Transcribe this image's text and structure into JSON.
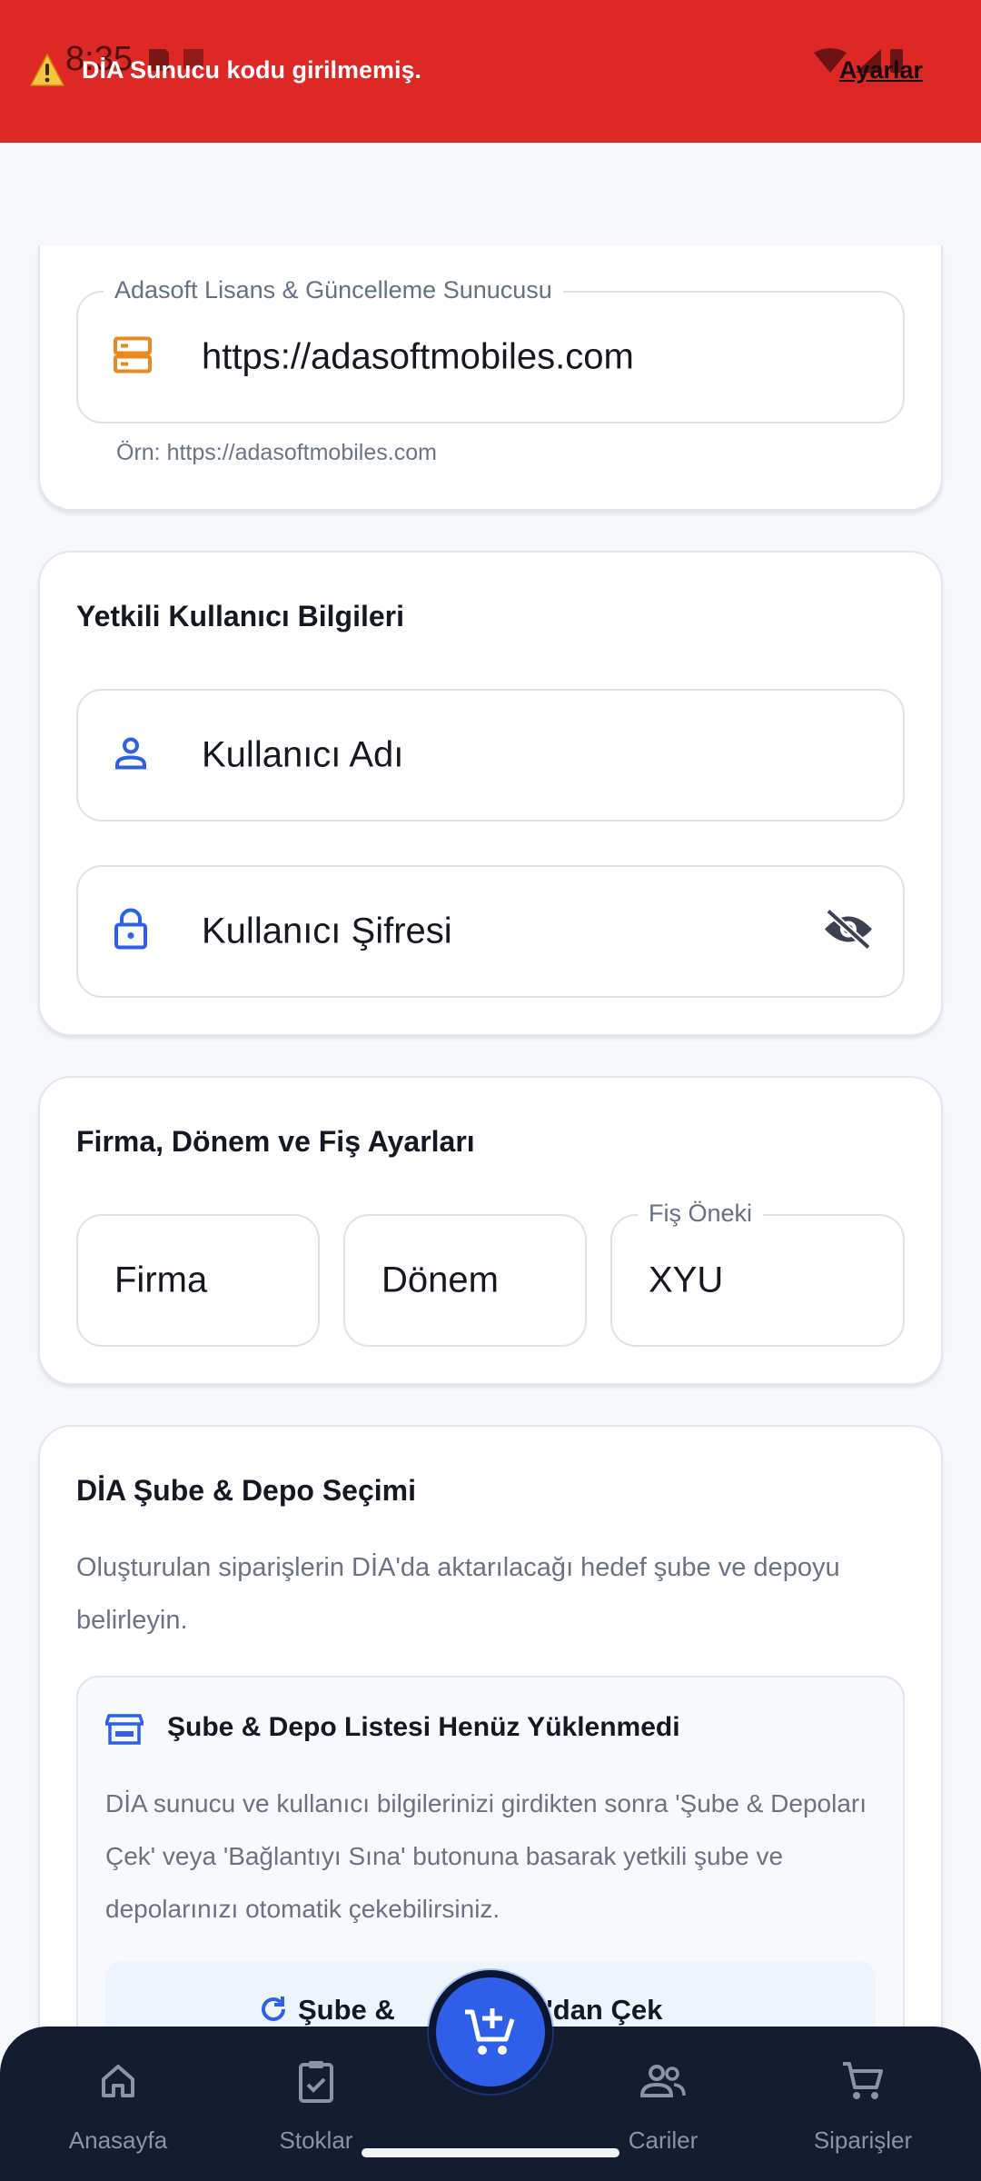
{
  "status_bar": {
    "time": "8:35"
  },
  "banner": {
    "message": "DİA Sunucu kodu girilmemiş.",
    "settings_link": "Ayarlar",
    "color": "#dd2826"
  },
  "server_card": {
    "field_label": "Adasoft Lisans & Güncelleme Sunucusu",
    "field_value": "https://adasoftmobiles.com",
    "helper": "Örn: https://adasoftmobiles.com",
    "icon": "server-icon"
  },
  "user_card": {
    "title": "Yetkili Kullanıcı Bilgileri",
    "username_placeholder": "Kullanıcı Adı",
    "password_placeholder": "Kullanıcı Şifresi"
  },
  "company_card": {
    "title": "Firma, Dönem ve Fiş Ayarları",
    "firma_placeholder": "Firma",
    "donem_placeholder": "Dönem",
    "fis_label": "Fiş Öneki",
    "fis_value": "XYU"
  },
  "branch_card": {
    "title": "DİA Şube & Depo Seçimi",
    "description": "Oluşturulan siparişlerin DİA'da aktarılacağı hedef şube ve depoyu belirleyin.",
    "notice_title": "Şube & Depo Listesi Henüz Yüklenmedi",
    "notice_body": "DİA sunucu ve kullanıcı bilgilerinizi girdikten sonra 'Şube & Depoları Çek' veya 'Bağlantıyı Sına' butonuna basarak yetkili şube ve depolarınızı otomatik çekebilirsiniz.",
    "fetch_button_left": "Şube &",
    "fetch_button_right": "DİA'dan Çek"
  },
  "bottom_nav": {
    "items": [
      {
        "label": "Anasayfa",
        "icon": "home-icon"
      },
      {
        "label": "Stoklar",
        "icon": "clipboard-check-icon"
      },
      {
        "label": "Cariler",
        "icon": "people-icon"
      },
      {
        "label": "Siparişler",
        "icon": "cart-icon"
      }
    ],
    "fab_icon": "add-to-cart-icon"
  },
  "colors": {
    "accent_blue": "#2f5fe8",
    "server_icon_orange": "#e8891e",
    "nav_background": "#141c30"
  }
}
